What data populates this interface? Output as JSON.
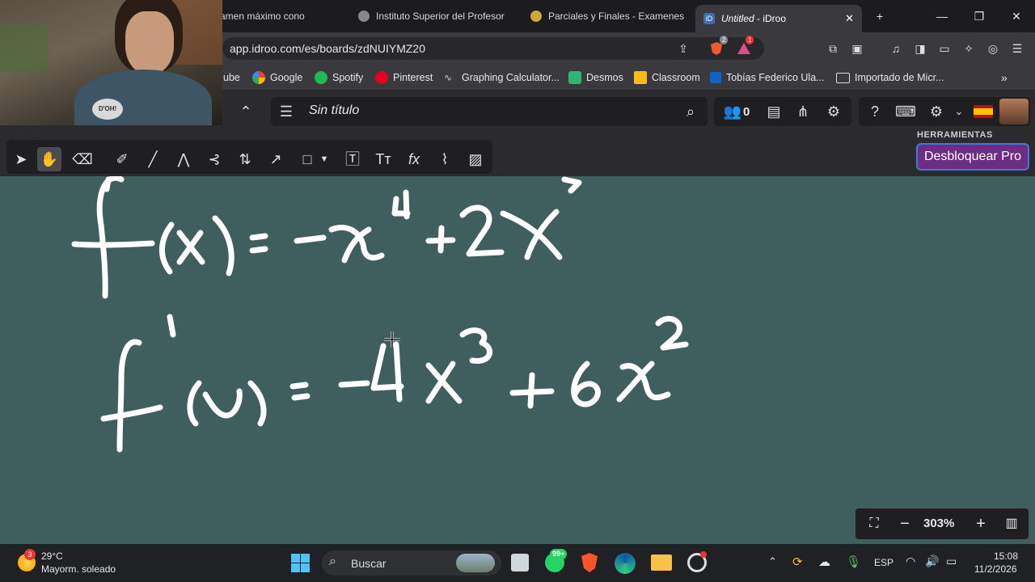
{
  "browser": {
    "tabs": [
      {
        "title": "amen máximo cono"
      },
      {
        "title": "Instituto Superior del Profesor"
      },
      {
        "title": "Parciales y Finales - Examenes"
      },
      {
        "title": "Untitled",
        "suffix": " - iDroo"
      }
    ],
    "url": "app.idroo.com/es/boards/zdNUIYMZ20",
    "notifications": {
      "brave": "2",
      "rewards": "1"
    },
    "bookmarks": [
      {
        "label": "ube",
        "icon": "youtube-icon"
      },
      {
        "label": "Google",
        "icon": "google-icon"
      },
      {
        "label": "Spotify",
        "icon": "spotify-icon"
      },
      {
        "label": "Pinterest",
        "icon": "pinterest-icon"
      },
      {
        "label": "Graphing Calculator...",
        "icon": "graph-icon"
      },
      {
        "label": "Desmos",
        "icon": "desmos-icon"
      },
      {
        "label": "Classroom",
        "icon": "classroom-icon"
      },
      {
        "label": "Tobías Federico Ula...",
        "icon": "linkedin-icon"
      },
      {
        "label": "Importado de Micr...",
        "icon": "folder-icon"
      }
    ]
  },
  "app": {
    "board_title": "Sin título",
    "users_count": "0",
    "tools_label": "HERRAMIENTAS",
    "pro_button": "Desbloquear Pro",
    "zoom": "303%",
    "colors": {
      "board": "#3f5f5f",
      "pro": "#6b2e84"
    }
  },
  "webcam": {
    "shirt_text": "D'OH!"
  },
  "taskbar": {
    "weather_temp": "29°C",
    "weather_desc": "Mayorm. soleado",
    "weather_badge": "3",
    "search_placeholder": "Buscar",
    "whatsapp_badge": "99+",
    "language": "ESP",
    "time": "15:08",
    "date": "11/2/2026"
  }
}
